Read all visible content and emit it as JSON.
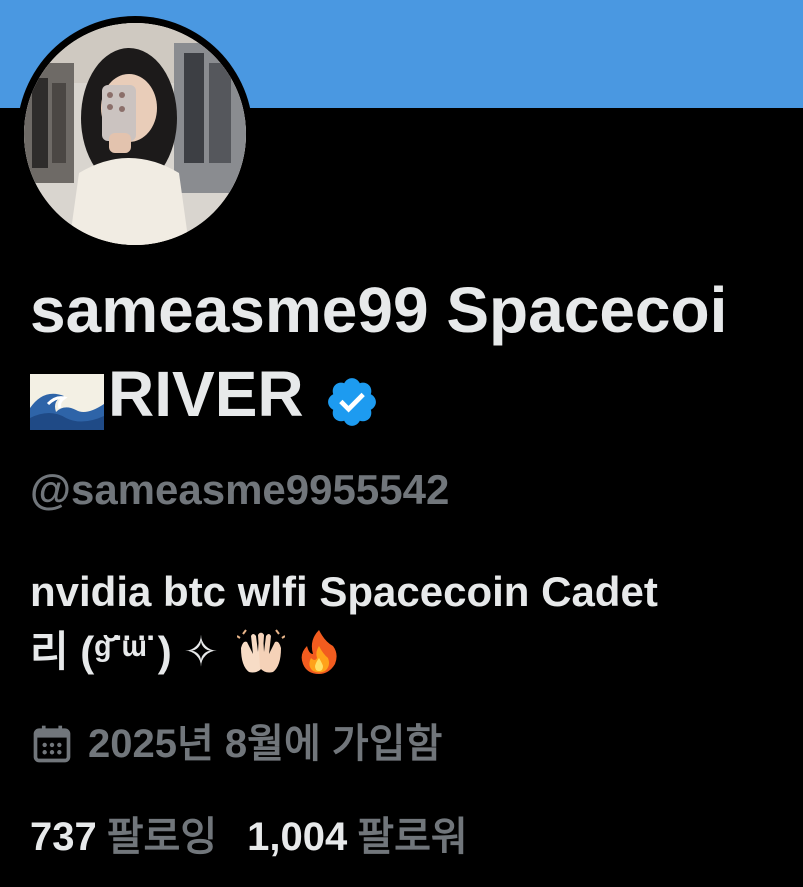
{
  "profile": {
    "display_name_line1": "sameasme99 Spacecoi",
    "display_name_line2": "RIVER",
    "handle": "@sameasme9955542",
    "bio_line1": "nvidia btc wlfi Spacecoin Cadet",
    "bio_line2": "리 (ᵍ̆ ̈ᵚ̈ ) ✧",
    "joined": "2025년 8월에 가입함",
    "following_count": "737",
    "following_label": "팔로잉",
    "followers_count": "1,004",
    "followers_label": "팔로워"
  },
  "icons": {
    "verified": "verified-badge-icon",
    "wave": "water-wave-emoji",
    "raised_hands": "raised-hands-emoji",
    "fire": "fire-emoji",
    "calendar": "calendar-icon"
  },
  "colors": {
    "banner": "#4A98E1",
    "background": "#000000",
    "primary_text": "#E7E9EA",
    "secondary_text": "#71767B",
    "verified": "#1D9BF0"
  }
}
